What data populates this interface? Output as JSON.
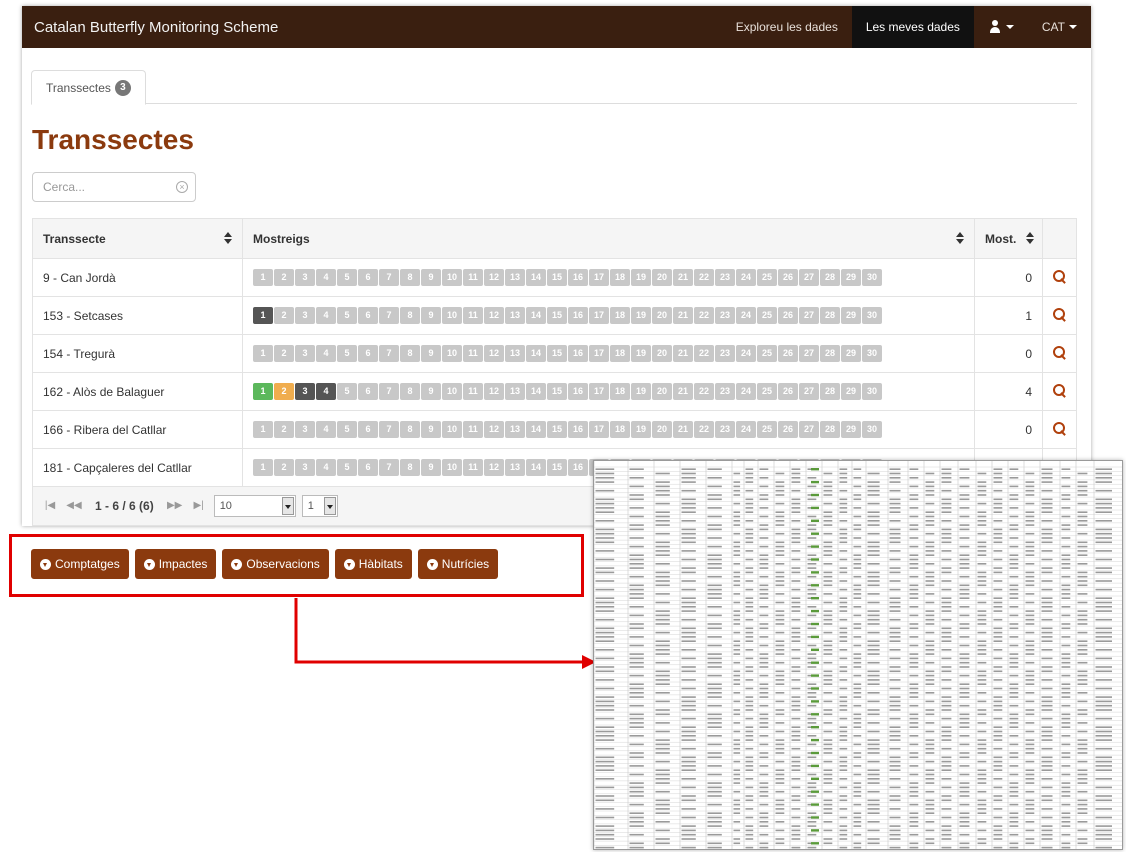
{
  "navbar": {
    "brand": "Catalan Butterfly Monitoring Scheme",
    "links": [
      "Exploreu les dades",
      "Les meves dades"
    ],
    "language": "CAT"
  },
  "tabs": [
    {
      "label": "Transsectes",
      "badge": "3"
    }
  ],
  "page_title": "Transsectes",
  "search": {
    "placeholder": "Cerca..."
  },
  "table": {
    "headers": {
      "transect": "Transsecte",
      "samplings": "Mostreigs",
      "count": "Most."
    },
    "rows": [
      {
        "name": "9 - Can Jordà",
        "count": "0",
        "status": []
      },
      {
        "name": "153 - Setcases",
        "count": "1",
        "status": [
          "dark"
        ]
      },
      {
        "name": "154 - Tregurà",
        "count": "0",
        "status": []
      },
      {
        "name": "162 - Alòs de Balaguer",
        "count": "4",
        "status": [
          "green",
          "orange",
          "dark",
          "dark"
        ]
      },
      {
        "name": "166 - Ribera del Catllar",
        "count": "0",
        "status": []
      },
      {
        "name": "181 - Capçaleres del Catllar",
        "count": "",
        "status": []
      }
    ],
    "chip_numbers": [
      "1",
      "2",
      "3",
      "4",
      "5",
      "6",
      "7",
      "8",
      "9",
      "10",
      "11",
      "12",
      "13",
      "14",
      "15",
      "16",
      "17",
      "18",
      "19",
      "20",
      "21",
      "22",
      "23",
      "24",
      "25",
      "26",
      "27",
      "28",
      "29",
      "30"
    ]
  },
  "pagination": {
    "info": "1 - 6 / 6 (6)",
    "page_size": "10",
    "page": "1"
  },
  "downloads": [
    {
      "label": "Comptatges"
    },
    {
      "label": "Impactes"
    },
    {
      "label": "Observacions"
    },
    {
      "label": "Hàbitats"
    },
    {
      "label": "Nutrícies"
    }
  ],
  "colors": {
    "brand_dark": "#3a1f10",
    "accent": "#8b3a0e",
    "highlight": "#e00000"
  }
}
